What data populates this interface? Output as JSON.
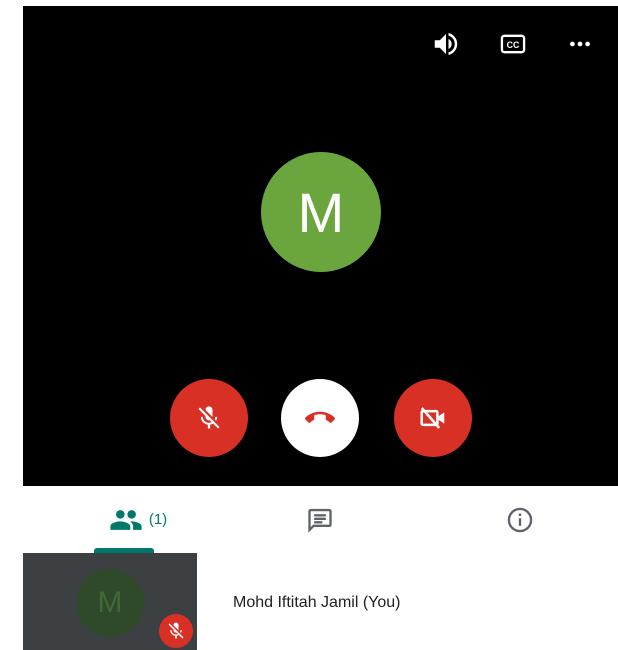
{
  "call": {
    "top_bar": {
      "speaker_icon": "speaker-icon",
      "captions_icon": "closed-captions-icon",
      "more_icon": "more-options-icon"
    },
    "main_avatar": {
      "initial": "M",
      "color": "#6aa53d"
    },
    "controls": {
      "mic": {
        "icon": "mic-off-icon",
        "color": "#d93025"
      },
      "hangup": {
        "icon": "phone-hangup-icon",
        "color": "#ffffff"
      },
      "camera": {
        "icon": "camera-off-icon",
        "color": "#d93025"
      }
    }
  },
  "tabs": {
    "people": {
      "icon": "people-icon",
      "count": "(1)"
    },
    "chat": {
      "icon": "chat-icon"
    },
    "info": {
      "icon": "info-icon"
    },
    "accent": "#00796b"
  },
  "participants": [
    {
      "initial": "M",
      "name": "Mohd Iftitah Jamil (You)",
      "muted_icon": "mic-off-icon"
    }
  ]
}
